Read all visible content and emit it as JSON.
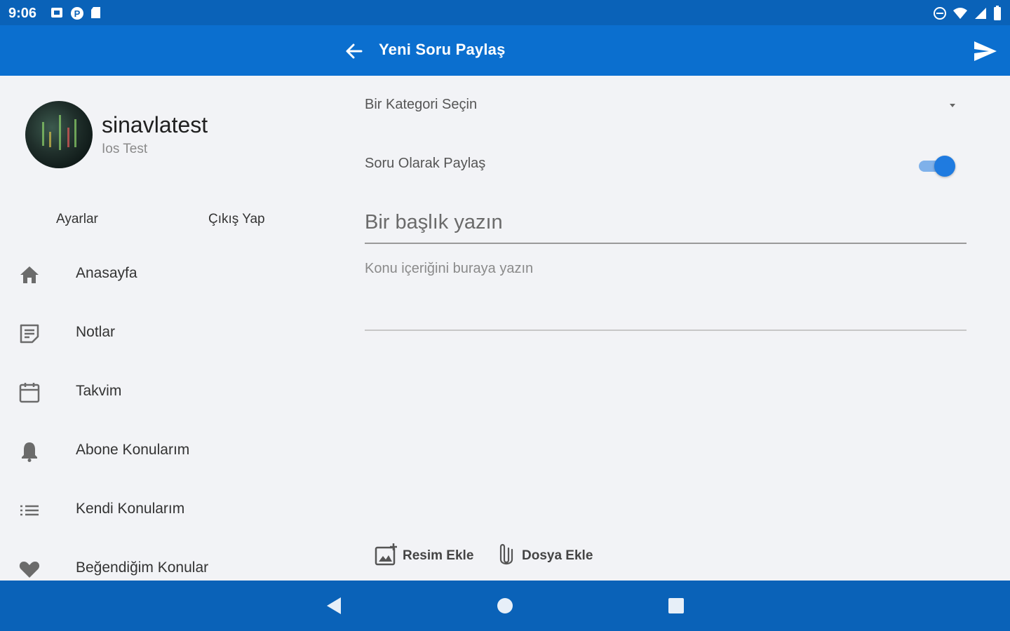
{
  "status_bar": {
    "time": "9:06",
    "left_icons": [
      "notification-square-icon",
      "pinterest-icon",
      "sd-card-icon"
    ],
    "right_icons": [
      "dnd-icon",
      "wifi-icon",
      "signal-icon",
      "battery-icon"
    ]
  },
  "app_bar": {
    "title": "Yeni Soru Paylaş",
    "back_icon": "arrow-left-icon",
    "send_icon": "send-icon",
    "color": "#0b6fcf"
  },
  "drawer": {
    "username": "sinavlatest",
    "subtitle": "Ios Test",
    "actions": [
      {
        "label": "Ayarlar"
      },
      {
        "label": "Çıkış Yap"
      }
    ],
    "items": [
      {
        "label": "Anasayfa",
        "icon": "home-icon"
      },
      {
        "label": "Notlar",
        "icon": "notes-icon"
      },
      {
        "label": "Takvim",
        "icon": "calendar-icon"
      },
      {
        "label": "Abone Konularım",
        "icon": "bell-icon"
      },
      {
        "label": "Kendi Konularım",
        "icon": "list-icon"
      },
      {
        "label": "Beğendiğim Konular",
        "icon": "heart-icon"
      }
    ]
  },
  "form": {
    "category_select": {
      "value": "Bir Kategori Seçin"
    },
    "share_as_question": {
      "label": "Soru Olarak Paylaş",
      "enabled": true
    },
    "title_input": {
      "value": "",
      "placeholder": "Bir başlık yazın"
    },
    "content_input": {
      "value": "",
      "placeholder": "Konu içeriğini buraya yazın"
    },
    "attachments": [
      {
        "label": "Resim Ekle",
        "icon": "add-image-icon"
      },
      {
        "label": "Dosya Ekle",
        "icon": "paperclip-icon"
      }
    ]
  },
  "nav_bar": {
    "buttons": [
      "back-triangle-icon",
      "home-circle-icon",
      "recents-square-icon"
    ],
    "color": "#0a62b8"
  }
}
